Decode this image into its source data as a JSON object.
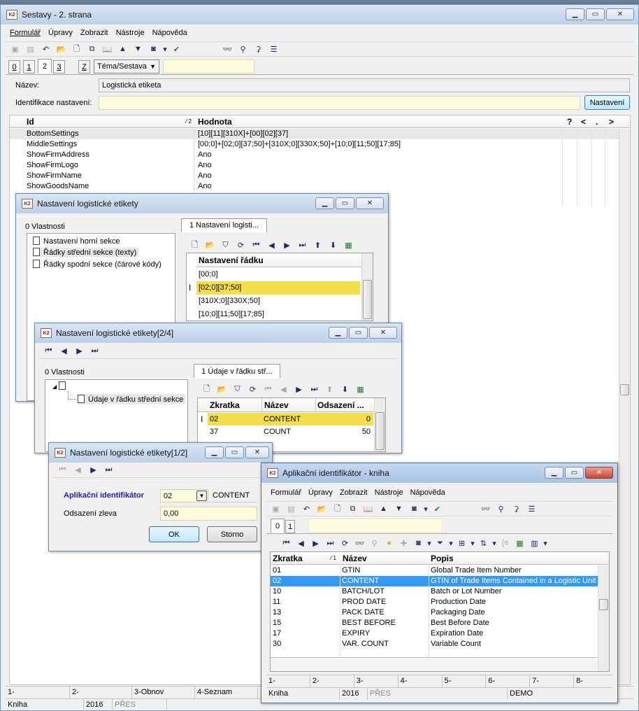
{
  "main": {
    "title": "Sestavy - 2. strana",
    "menu": [
      "Formulář",
      "Úpravy",
      "Zobrazit",
      "Nástroje",
      "Nápověda"
    ],
    "tabs": [
      "0",
      "1",
      "2",
      "3"
    ],
    "tab_z": "Z",
    "theme_select": "Téma/Sestava",
    "nazev_label": "Název:",
    "nazev_value": "Logistická etiketa",
    "ident_label": "Identifikace nastavení:",
    "nastaveni_button": "Nastavení",
    "grid_headers": {
      "id": "Id",
      "sort": "⁄ 2",
      "value": "Hodnota",
      "q": "?",
      "lt": "<",
      "dot": ".",
      "gt": ">"
    },
    "rows": [
      {
        "id": "BottomSettings",
        "value": "[10][11][310X]+[00][02][37]"
      },
      {
        "id": "MiddleSettings",
        "value": "[00;0]+[02;0][37;50]+[310X;0][330X;50]+[10;0][11;50][17;85]"
      },
      {
        "id": "ShowFirmAddress",
        "value": "Ano"
      },
      {
        "id": "ShowFirmLogo",
        "value": "Ano"
      },
      {
        "id": "ShowFirmName",
        "value": "Ano"
      },
      {
        "id": "ShowGoodsName",
        "value": "Ano"
      }
    ],
    "status_top": [
      "1-",
      "2-",
      "3-Obnov",
      "4-Seznam"
    ],
    "status_bottom": [
      "Kniha",
      "2016",
      "PŘES"
    ]
  },
  "w1": {
    "title": "Nastavení logistické etikety",
    "vlastnosti": "0 Vlastnosti",
    "tab": "1 Nastavení logisti...",
    "tree": [
      "Nastavení horní sekce",
      "Řádky střední sekce (texty)",
      "Řádky spodní sekce (čárové kódy)"
    ],
    "grid_header": "Nastavení řádku",
    "rows": [
      "[00;0]",
      "[02;0][37;50]",
      "[310X;0][330X;50]",
      "[10;0][11;50][17;85]"
    ]
  },
  "w2": {
    "title": "Nastavení logistické etikety[2/4]",
    "vlastnosti": "0 Vlastnosti",
    "tab": "1 Údaje v řádku stř...",
    "tree_child": "Údaje v řádku střední sekce",
    "headers": [
      "Zkratka",
      "Název",
      "Odsazení ..."
    ],
    "rows": [
      {
        "z": "02",
        "n": "CONTENT",
        "o": "0"
      },
      {
        "z": "37",
        "n": "COUNT",
        "o": "50"
      }
    ]
  },
  "w3": {
    "title": "Nastavení logistické etikety[1/2]",
    "ai_label": "Aplikační identifikátor",
    "ai_value": "02",
    "ai_name": "CONTENT",
    "ods_label": "Odsazení zleva",
    "ods_value": "0,00",
    "ok": "OK",
    "storno": "Storno"
  },
  "w4": {
    "title": "Aplikační identifikátor - kniha",
    "menu": [
      "Formulář",
      "Úpravy",
      "Zobrazit",
      "Nástroje",
      "Nápověda"
    ],
    "tabs": [
      "0",
      "1"
    ],
    "headers": {
      "z": "Zkratka",
      "sort": "⁄ 1",
      "n": "Název",
      "p": "Popis"
    },
    "rows": [
      {
        "z": "01",
        "n": "GTIN",
        "p": "Global Trade Item Number"
      },
      {
        "z": "02",
        "n": "CONTENT",
        "p": "GTIN of Trade Items Contained in a Logistic Unit"
      },
      {
        "z": "10",
        "n": "BATCH/LOT",
        "p": "Batch or Lot Number"
      },
      {
        "z": "11",
        "n": "PROD DATE",
        "p": "Production Date"
      },
      {
        "z": "13",
        "n": "PACK DATE",
        "p": "Packaging Date"
      },
      {
        "z": "15",
        "n": "BEST BEFORE",
        "p": "Best Before Date"
      },
      {
        "z": "17",
        "n": "EXPIRY",
        "p": "Expiration Date"
      },
      {
        "z": "30",
        "n": "VAR. COUNT",
        "p": "Variable Count"
      }
    ],
    "fkeys": [
      "1-",
      "2-",
      "3-",
      "4-",
      "5-",
      "6-",
      "7-",
      "8-"
    ],
    "status": [
      "Kniha",
      "2016",
      "PŘES",
      "DEMO"
    ]
  }
}
